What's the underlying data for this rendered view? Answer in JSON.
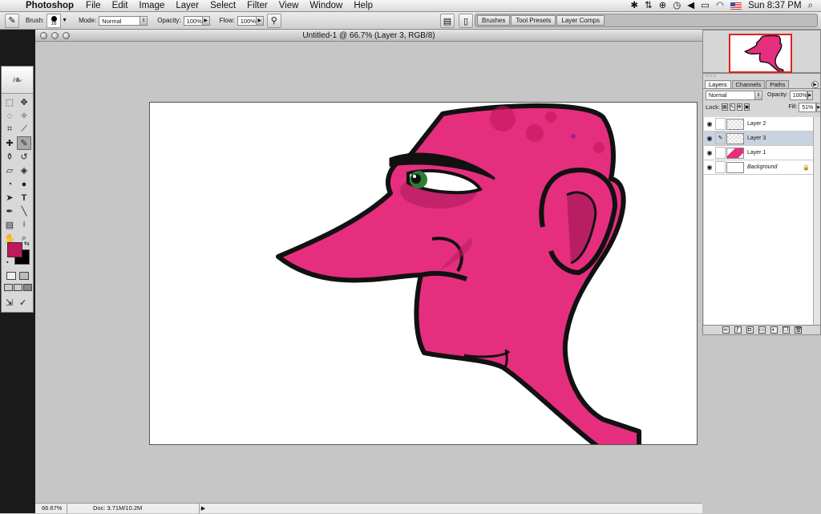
{
  "menubar": {
    "app_name": "Photoshop",
    "items": [
      "File",
      "Edit",
      "Image",
      "Layer",
      "Select",
      "Filter",
      "View",
      "Window",
      "Help"
    ],
    "clock": "Sun 8:37 PM"
  },
  "options": {
    "brush_label": "Brush:",
    "brush_size": "16",
    "mode_label": "Mode:",
    "mode_value": "Normal",
    "opacity_label": "Opacity:",
    "opacity_value": "100%",
    "flow_label": "Flow:",
    "flow_value": "100%",
    "well_tabs": [
      "Brushes",
      "Tool Presets",
      "Layer Comps"
    ]
  },
  "document": {
    "title": "Untitled-1 @ 66.7% (Layer 3, RGB/8)",
    "zoom": "66.67%",
    "doc_size": "Doc: 3.71M/10.2M"
  },
  "layers_panel": {
    "tabs": [
      "Layers",
      "Channels",
      "Paths"
    ],
    "blend_mode": "Normal",
    "opacity_label": "Opacity:",
    "opacity_value": "100%",
    "lock_label": "Lock:",
    "fill_label": "Fill:",
    "fill_value": "51%",
    "layers": [
      {
        "name": "Layer 2"
      },
      {
        "name": "Layer 3"
      },
      {
        "name": "Layer 1"
      },
      {
        "name": "Background"
      }
    ]
  },
  "colors": {
    "foreground": "#c2185b",
    "background": "#000000",
    "skin": "#e62e7f",
    "eye_iris": "#2e7d32"
  },
  "icons": {
    "apple": "apple-icon",
    "brush_tool": "brush-icon",
    "airbrush": "airbrush-icon"
  }
}
